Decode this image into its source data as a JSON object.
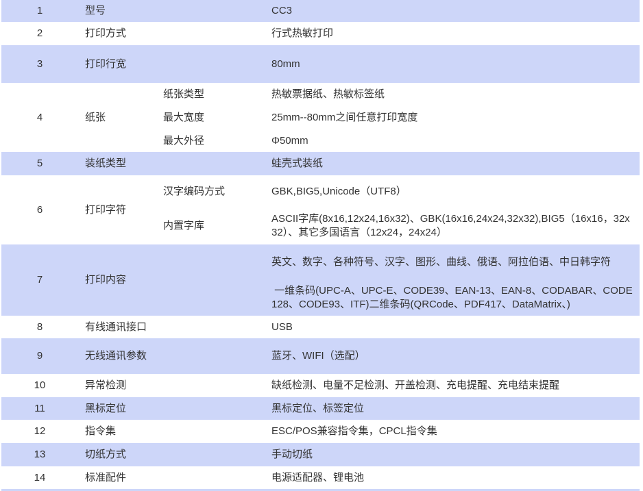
{
  "colors": {
    "stripe": "#cdd6f9",
    "text": "#333333"
  },
  "spec_table": {
    "rows": [
      {
        "no": "1",
        "item": "型号",
        "value": "CC3"
      },
      {
        "no": "2",
        "item": "打印方式",
        "value": "行式热敏打印"
      },
      {
        "no": "3",
        "item": "打印行宽",
        "value": "80mm"
      },
      {
        "no": "4",
        "item": "纸张",
        "subs": [
          {
            "label": "纸张类型",
            "value": "热敏票据纸、热敏标签纸"
          },
          {
            "label": "最大宽度",
            "value": "25mm--80mm之间任意打印宽度"
          },
          {
            "label": "最大外径",
            "value": "Φ50mm"
          }
        ]
      },
      {
        "no": "5",
        "item": "装纸类型",
        "value": "蛙壳式装纸"
      },
      {
        "no": "6",
        "item": "打印字符",
        "subs": [
          {
            "label": "汉字编码方式",
            "value": "GBK,BIG5,Unicode（UTF8）"
          },
          {
            "label": "内置字库",
            "value": "ASCII字库(8x16,12x24,16x32)、GBK(16x16,24x24,32x32),BIG5（16x16，32x32）、其它多国语言（12x24，24x24）"
          }
        ]
      },
      {
        "no": "7",
        "item": "打印内容",
        "paragraphs": [
          "英文、数字、各种符号、汉字、图形、曲线、俄语、阿拉伯语、中日韩字符",
          " 一维条码(UPC-A、UPC-E、CODE39、EAN-13、EAN-8、CODABAR、CODE128、CODE93、ITF)二维条码(QRCode、PDF417、DataMatrix、)"
        ]
      },
      {
        "no": "8",
        "item": "有线通讯接口",
        "value": "USB"
      },
      {
        "no": "9",
        "item": "无线通讯参数",
        "value": "蓝牙、WIFI（选配）"
      },
      {
        "no": "10",
        "item": "异常检测",
        "value": "缺纸检测、电量不足检测、开盖检测、充电提醒、充电结束提醒"
      },
      {
        "no": "11",
        "item": "黑标定位",
        "value": "黑标定位、标签定位"
      },
      {
        "no": "12",
        "item": "指令集",
        "value": "ESC/POS兼容指令集，CPCL指令集"
      },
      {
        "no": "13",
        "item": "切纸方式",
        "value": "手动切纸"
      },
      {
        "no": "14",
        "item": "标准配件",
        "value": "电源适配器、锂电池"
      }
    ]
  }
}
